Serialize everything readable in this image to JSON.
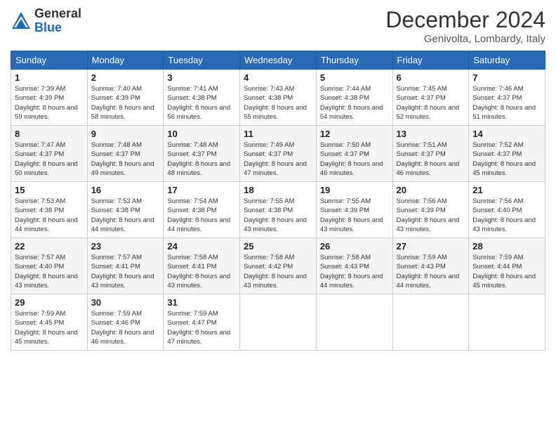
{
  "header": {
    "logo_general": "General",
    "logo_blue": "Blue",
    "month_title": "December 2024",
    "location": "Genivolta, Lombardy, Italy"
  },
  "calendar": {
    "days_of_week": [
      "Sunday",
      "Monday",
      "Tuesday",
      "Wednesday",
      "Thursday",
      "Friday",
      "Saturday"
    ],
    "weeks": [
      [
        {
          "day": "1",
          "sunrise": "Sunrise: 7:39 AM",
          "sunset": "Sunset: 4:39 PM",
          "daylight": "Daylight: 8 hours and 59 minutes."
        },
        {
          "day": "2",
          "sunrise": "Sunrise: 7:40 AM",
          "sunset": "Sunset: 4:39 PM",
          "daylight": "Daylight: 8 hours and 58 minutes."
        },
        {
          "day": "3",
          "sunrise": "Sunrise: 7:41 AM",
          "sunset": "Sunset: 4:38 PM",
          "daylight": "Daylight: 8 hours and 56 minutes."
        },
        {
          "day": "4",
          "sunrise": "Sunrise: 7:43 AM",
          "sunset": "Sunset: 4:38 PM",
          "daylight": "Daylight: 8 hours and 55 minutes."
        },
        {
          "day": "5",
          "sunrise": "Sunrise: 7:44 AM",
          "sunset": "Sunset: 4:38 PM",
          "daylight": "Daylight: 8 hours and 54 minutes."
        },
        {
          "day": "6",
          "sunrise": "Sunrise: 7:45 AM",
          "sunset": "Sunset: 4:37 PM",
          "daylight": "Daylight: 8 hours and 52 minutes."
        },
        {
          "day": "7",
          "sunrise": "Sunrise: 7:46 AM",
          "sunset": "Sunset: 4:37 PM",
          "daylight": "Daylight: 8 hours and 51 minutes."
        }
      ],
      [
        {
          "day": "8",
          "sunrise": "Sunrise: 7:47 AM",
          "sunset": "Sunset: 4:37 PM",
          "daylight": "Daylight: 8 hours and 50 minutes."
        },
        {
          "day": "9",
          "sunrise": "Sunrise: 7:48 AM",
          "sunset": "Sunset: 4:37 PM",
          "daylight": "Daylight: 8 hours and 49 minutes."
        },
        {
          "day": "10",
          "sunrise": "Sunrise: 7:48 AM",
          "sunset": "Sunset: 4:37 PM",
          "daylight": "Daylight: 8 hours and 48 minutes."
        },
        {
          "day": "11",
          "sunrise": "Sunrise: 7:49 AM",
          "sunset": "Sunset: 4:37 PM",
          "daylight": "Daylight: 8 hours and 47 minutes."
        },
        {
          "day": "12",
          "sunrise": "Sunrise: 7:50 AM",
          "sunset": "Sunset: 4:37 PM",
          "daylight": "Daylight: 8 hours and 46 minutes."
        },
        {
          "day": "13",
          "sunrise": "Sunrise: 7:51 AM",
          "sunset": "Sunset: 4:37 PM",
          "daylight": "Daylight: 8 hours and 46 minutes."
        },
        {
          "day": "14",
          "sunrise": "Sunrise: 7:52 AM",
          "sunset": "Sunset: 4:37 PM",
          "daylight": "Daylight: 8 hours and 45 minutes."
        }
      ],
      [
        {
          "day": "15",
          "sunrise": "Sunrise: 7:53 AM",
          "sunset": "Sunset: 4:38 PM",
          "daylight": "Daylight: 8 hours and 44 minutes."
        },
        {
          "day": "16",
          "sunrise": "Sunrise: 7:53 AM",
          "sunset": "Sunset: 4:38 PM",
          "daylight": "Daylight: 8 hours and 44 minutes."
        },
        {
          "day": "17",
          "sunrise": "Sunrise: 7:54 AM",
          "sunset": "Sunset: 4:38 PM",
          "daylight": "Daylight: 8 hours and 44 minutes."
        },
        {
          "day": "18",
          "sunrise": "Sunrise: 7:55 AM",
          "sunset": "Sunset: 4:38 PM",
          "daylight": "Daylight: 8 hours and 43 minutes."
        },
        {
          "day": "19",
          "sunrise": "Sunrise: 7:55 AM",
          "sunset": "Sunset: 4:39 PM",
          "daylight": "Daylight: 8 hours and 43 minutes."
        },
        {
          "day": "20",
          "sunrise": "Sunrise: 7:56 AM",
          "sunset": "Sunset: 4:39 PM",
          "daylight": "Daylight: 8 hours and 43 minutes."
        },
        {
          "day": "21",
          "sunrise": "Sunrise: 7:56 AM",
          "sunset": "Sunset: 4:40 PM",
          "daylight": "Daylight: 8 hours and 43 minutes."
        }
      ],
      [
        {
          "day": "22",
          "sunrise": "Sunrise: 7:57 AM",
          "sunset": "Sunset: 4:40 PM",
          "daylight": "Daylight: 8 hours and 43 minutes."
        },
        {
          "day": "23",
          "sunrise": "Sunrise: 7:57 AM",
          "sunset": "Sunset: 4:41 PM",
          "daylight": "Daylight: 8 hours and 43 minutes."
        },
        {
          "day": "24",
          "sunrise": "Sunrise: 7:58 AM",
          "sunset": "Sunset: 4:41 PM",
          "daylight": "Daylight: 8 hours and 43 minutes."
        },
        {
          "day": "25",
          "sunrise": "Sunrise: 7:58 AM",
          "sunset": "Sunset: 4:42 PM",
          "daylight": "Daylight: 8 hours and 43 minutes."
        },
        {
          "day": "26",
          "sunrise": "Sunrise: 7:58 AM",
          "sunset": "Sunset: 4:43 PM",
          "daylight": "Daylight: 8 hours and 44 minutes."
        },
        {
          "day": "27",
          "sunrise": "Sunrise: 7:59 AM",
          "sunset": "Sunset: 4:43 PM",
          "daylight": "Daylight: 8 hours and 44 minutes."
        },
        {
          "day": "28",
          "sunrise": "Sunrise: 7:59 AM",
          "sunset": "Sunset: 4:44 PM",
          "daylight": "Daylight: 8 hours and 45 minutes."
        }
      ],
      [
        {
          "day": "29",
          "sunrise": "Sunrise: 7:59 AM",
          "sunset": "Sunset: 4:45 PM",
          "daylight": "Daylight: 8 hours and 45 minutes."
        },
        {
          "day": "30",
          "sunrise": "Sunrise: 7:59 AM",
          "sunset": "Sunset: 4:46 PM",
          "daylight": "Daylight: 8 hours and 46 minutes."
        },
        {
          "day": "31",
          "sunrise": "Sunrise: 7:59 AM",
          "sunset": "Sunset: 4:47 PM",
          "daylight": "Daylight: 8 hours and 47 minutes."
        },
        null,
        null,
        null,
        null
      ]
    ]
  }
}
